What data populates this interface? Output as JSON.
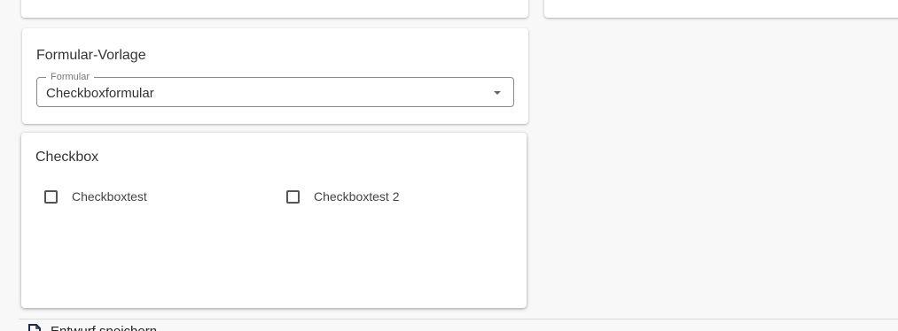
{
  "form_template": {
    "title": "Formular-Vorlage",
    "select": {
      "legend": "Formular",
      "value": "Checkboxformular"
    }
  },
  "checkbox_section": {
    "title": "Checkbox",
    "items": [
      {
        "label": "Checkboxtest",
        "checked": false
      },
      {
        "label": "Checkboxtest 2",
        "checked": false
      }
    ]
  },
  "footer": {
    "icon": "document-edit-icon",
    "text": "Entwurf speichern"
  }
}
